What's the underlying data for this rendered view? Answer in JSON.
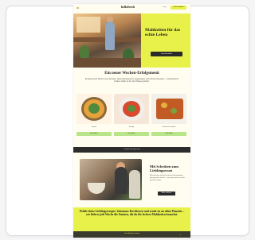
{
  "nav": {
    "logo": "hellofresh",
    "login": "Login",
    "cta": "Jetzt bestellen"
  },
  "hero": {
    "title": "Mahlzeiten für das echte Leben",
    "button": "Jetzt bestellen"
  },
  "menu_section": {
    "title": "Ein neuer Wochen-Erfolgsmenü",
    "text": "Entdecke jede Woche neue Rezepte: abwechslungsreich, ausgewogen und schnell zubereitet – vorportionierte Zutaten direkt zu dir nach Hause geliefert."
  },
  "dishes": [
    {
      "label": "Bowls",
      "button": "Zum Menü"
    },
    {
      "label": "Family",
      "button": "Zum Menü"
    },
    {
      "label": "Schnell & einfach",
      "button": "Zum Menü"
    }
  ],
  "dark_bar": "Kochen leicht gemacht",
  "family": {
    "title": "Mit Schritten zum Lieblingsessen",
    "text": "Mit einfachen Schritt-für-Schritt Rezeptkarten gelingt jedes Gericht – auch gemeinsam mit der ganzen Familie.",
    "button": "Mehr erfahren"
  },
  "yellow_band": {
    "text": "Wähle deine Lieblingsrezepte, bekomme Kochboxen und sende sie an deine Haustür – wir liefern jede Woche die Zutaten, die du für leckere Mahlzeiten brauchst."
  },
  "footer": {
    "label": "Jetzt Rabatt sichern",
    "arrow": "›"
  },
  "colors": {
    "accent": "#e8f14a",
    "dark": "#2c2c2c",
    "green": "#b9e58a"
  }
}
